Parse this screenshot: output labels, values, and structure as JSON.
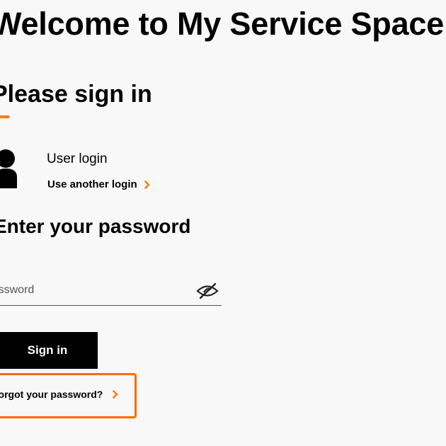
{
  "page": {
    "title": "Welcome to My Service Space"
  },
  "signin": {
    "heading": "Please sign in",
    "user_label": "User login",
    "another_login_label": "Use another login",
    "password_heading": "Enter your password",
    "password_placeholder": "Password",
    "password_value": "",
    "submit_label": "Sign in",
    "forgot_label": "Forgot your password?"
  },
  "icons": {
    "user": "user-icon",
    "eye_toggle": "eye-slash-icon",
    "chevron": "chevron-right-icon"
  },
  "colors": {
    "accent": "#ff7900",
    "highlight_border": "#ff6a00",
    "button_bg": "#000000",
    "button_text": "#ffffff",
    "background": "#f8f8f8"
  }
}
